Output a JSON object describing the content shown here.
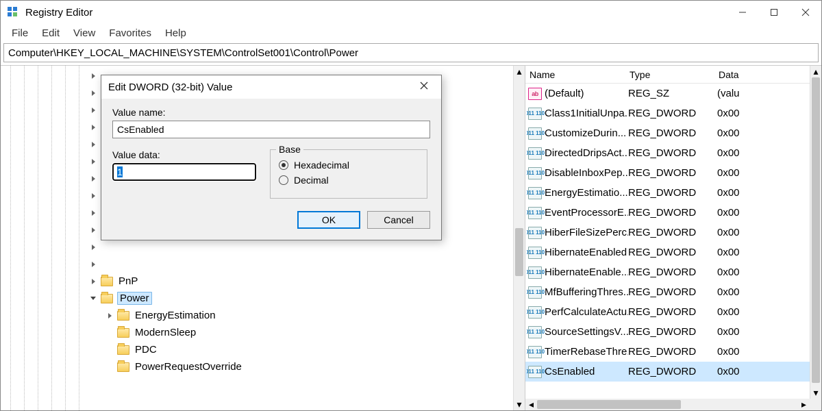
{
  "window": {
    "title": "Registry Editor"
  },
  "menu": {
    "file": "File",
    "edit": "Edit",
    "view": "View",
    "favorites": "Favorites",
    "help": "Help"
  },
  "address": "Computer\\HKEY_LOCAL_MACHINE\\SYSTEM\\ControlSet001\\Control\\Power",
  "tree": {
    "pnp": "PnP",
    "power": "Power",
    "energy": "EnergyEstimation",
    "modern": "ModernSleep",
    "pdc": "PDC",
    "pro": "PowerRequestOverride"
  },
  "columns": {
    "name": "Name",
    "type": "Type",
    "data": "Data"
  },
  "rows": [
    {
      "icon": "str",
      "name": "(Default)",
      "type": "REG_SZ",
      "data": "(valu"
    },
    {
      "icon": "bin",
      "name": "Class1InitialUnpa...",
      "type": "REG_DWORD",
      "data": "0x00"
    },
    {
      "icon": "bin",
      "name": "CustomizeDurin...",
      "type": "REG_DWORD",
      "data": "0x00"
    },
    {
      "icon": "bin",
      "name": "DirectedDripsAct...",
      "type": "REG_DWORD",
      "data": "0x00"
    },
    {
      "icon": "bin",
      "name": "DisableInboxPep...",
      "type": "REG_DWORD",
      "data": "0x00"
    },
    {
      "icon": "bin",
      "name": "EnergyEstimatio...",
      "type": "REG_DWORD",
      "data": "0x00"
    },
    {
      "icon": "bin",
      "name": "EventProcessorE...",
      "type": "REG_DWORD",
      "data": "0x00"
    },
    {
      "icon": "bin",
      "name": "HiberFileSizePerc...",
      "type": "REG_DWORD",
      "data": "0x00"
    },
    {
      "icon": "bin",
      "name": "HibernateEnabled",
      "type": "REG_DWORD",
      "data": "0x00"
    },
    {
      "icon": "bin",
      "name": "HibernateEnable...",
      "type": "REG_DWORD",
      "data": "0x00"
    },
    {
      "icon": "bin",
      "name": "MfBufferingThres...",
      "type": "REG_DWORD",
      "data": "0x00"
    },
    {
      "icon": "bin",
      "name": "PerfCalculateActu...",
      "type": "REG_DWORD",
      "data": "0x00"
    },
    {
      "icon": "bin",
      "name": "SourceSettingsV...",
      "type": "REG_DWORD",
      "data": "0x00"
    },
    {
      "icon": "bin",
      "name": "TimerRebaseThre...",
      "type": "REG_DWORD",
      "data": "0x00"
    },
    {
      "icon": "bin",
      "name": "CsEnabled",
      "type": "REG_DWORD",
      "data": "0x00",
      "selected": true
    }
  ],
  "dialog": {
    "title": "Edit DWORD (32-bit) Value",
    "value_name_label": "Value name:",
    "value_name": "CsEnabled",
    "value_data_label": "Value data:",
    "value_data": "1",
    "base_label": "Base",
    "hex_label": "Hexadecimal",
    "dec_label": "Decimal",
    "ok": "OK",
    "cancel": "Cancel"
  }
}
